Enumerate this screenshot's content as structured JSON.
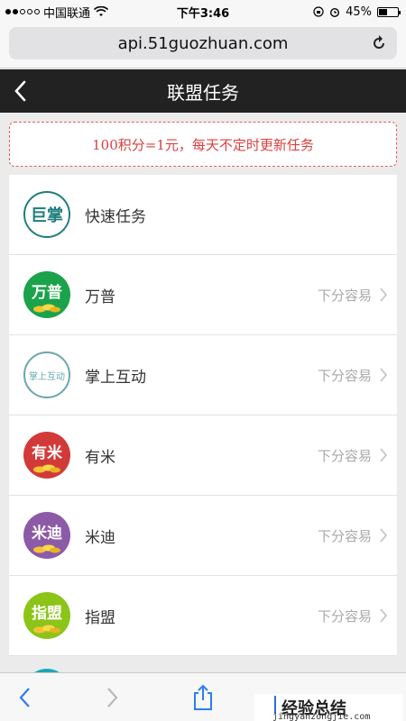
{
  "status_bar": {
    "carrier": "中国联通",
    "time": "下午3:46",
    "battery": "45%",
    "battery_level": 0.45
  },
  "browser": {
    "url": "api.51guozhuan.com"
  },
  "header": {
    "title": "联盟任务"
  },
  "notice": "100积分=1元，每天不定时更新任务",
  "tasks": [
    {
      "name": "快速任务",
      "logo_text": "巨掌",
      "logo_style": "outline",
      "color": "#1e7d7d",
      "hint": ""
    },
    {
      "name": "万普",
      "logo_text": "万普",
      "logo_style": "filled",
      "color": "#1aa34a",
      "hint": "下分容易"
    },
    {
      "name": "掌上互动",
      "logo_text": "掌上互动",
      "logo_style": "outline-light",
      "color": "#6aa6b0",
      "hint": "下分容易"
    },
    {
      "name": "有米",
      "logo_text": "有米",
      "logo_style": "filled",
      "color": "#d23a3a",
      "hint": "下分容易"
    },
    {
      "name": "米迪",
      "logo_text": "米迪",
      "logo_style": "filled",
      "color": "#8d5aa8",
      "hint": "下分容易"
    },
    {
      "name": "指盟",
      "logo_text": "指盟",
      "logo_style": "filled",
      "color": "#8cc41a",
      "hint": "下分容易"
    }
  ],
  "watermark": {
    "title": "经验总结",
    "subtitle": "jingyanzongjie.com"
  }
}
